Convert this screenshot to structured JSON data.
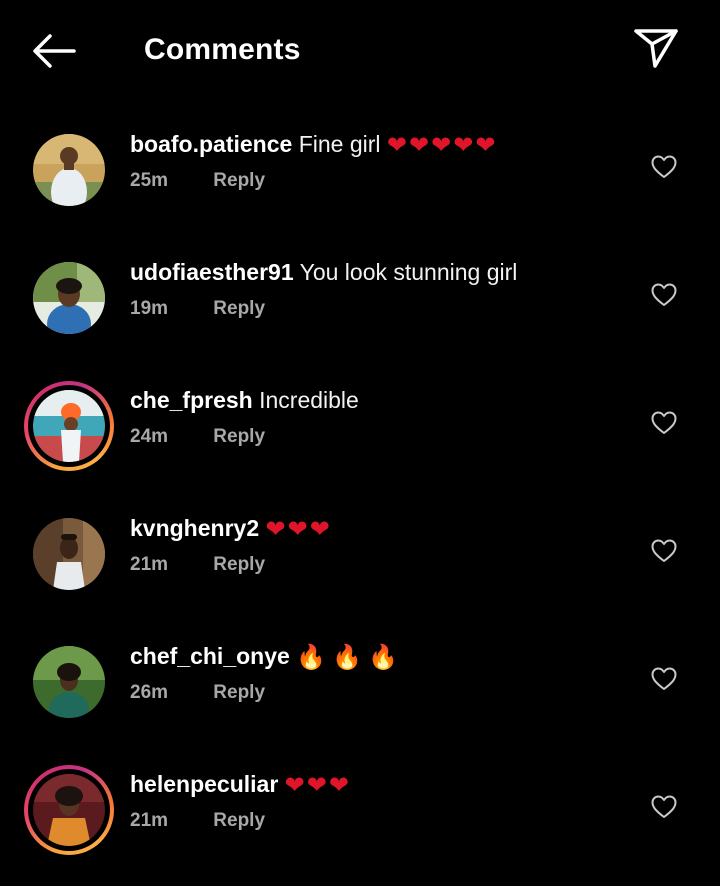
{
  "header": {
    "title": "Comments",
    "back_icon": "arrow-left-icon",
    "send_icon": "paper-plane-icon"
  },
  "colors": {
    "background": "#000000",
    "text": "#ffffff",
    "muted": "#a8a8a8",
    "heart": "#e0152a",
    "story_ring_start": "#f9a23a",
    "story_ring_end": "#c13584"
  },
  "reply_label": "Reply",
  "comments": [
    {
      "username": "boafo.patience",
      "text": "Fine girl",
      "emoji": "❤❤❤❤❤",
      "emoji_type": "heart",
      "time": "25m",
      "story_ring": false
    },
    {
      "username": "udofiaesther91",
      "text": "You look stunning girl",
      "emoji": "",
      "emoji_type": "",
      "time": "19m",
      "story_ring": false
    },
    {
      "username": "che_fpresh",
      "text": "Incredible",
      "emoji": "",
      "emoji_type": "",
      "time": "24m",
      "story_ring": true
    },
    {
      "username": "kvnghenry2",
      "text": "",
      "emoji": "❤❤❤",
      "emoji_type": "heart",
      "time": "21m",
      "story_ring": false
    },
    {
      "username": "chef_chi_onye",
      "text": "",
      "emoji": "🔥🔥🔥",
      "emoji_type": "fire",
      "time": "26m",
      "story_ring": false
    },
    {
      "username": "helenpeculiar",
      "text": "",
      "emoji": "❤❤❤",
      "emoji_type": "heart",
      "time": "21m",
      "story_ring": true
    }
  ]
}
